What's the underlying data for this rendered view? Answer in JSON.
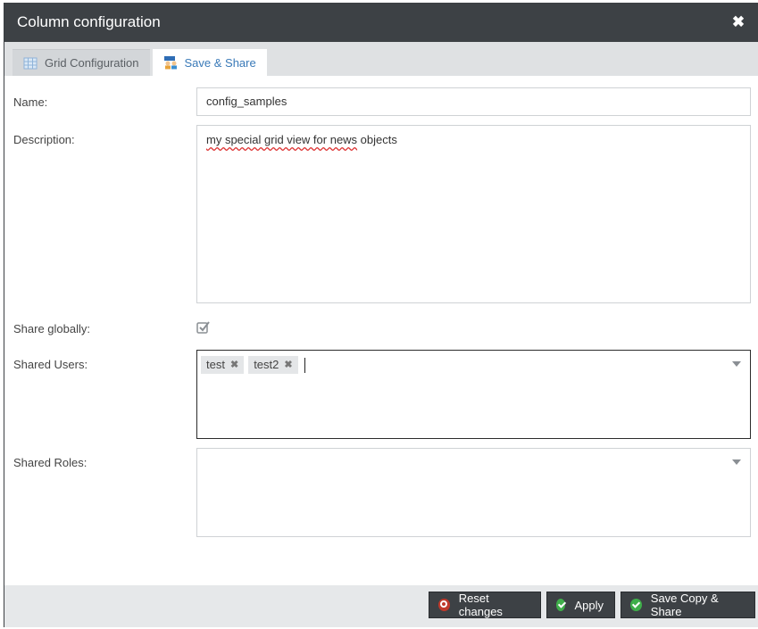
{
  "dialog": {
    "title": "Column configuration"
  },
  "tabs": [
    {
      "label": "Grid Configuration",
      "icon": "grid-icon",
      "active": false
    },
    {
      "label": "Save & Share",
      "icon": "share-users-icon",
      "active": true
    }
  ],
  "form": {
    "name_label": "Name:",
    "name_value": "config_samples",
    "description_label": "Description:",
    "description_value_underlined": "my special grid view for news",
    "description_value_rest": " objects",
    "share_globally_label": "Share globally:",
    "share_globally_checked": true,
    "shared_users_label": "Shared Users:",
    "shared_users": [
      "test",
      "test2"
    ],
    "shared_roles_label": "Shared Roles:",
    "shared_roles": []
  },
  "footer": {
    "reset_label": "Reset changes",
    "apply_label": "Apply",
    "save_copy_label": "Save Copy & Share"
  },
  "colors": {
    "titlebar": "#3d4145",
    "active_tab_text": "#3a7ab8",
    "button_bg": "#3d4145",
    "ok_green": "#3fae4a",
    "reset_red": "#c0392b"
  }
}
